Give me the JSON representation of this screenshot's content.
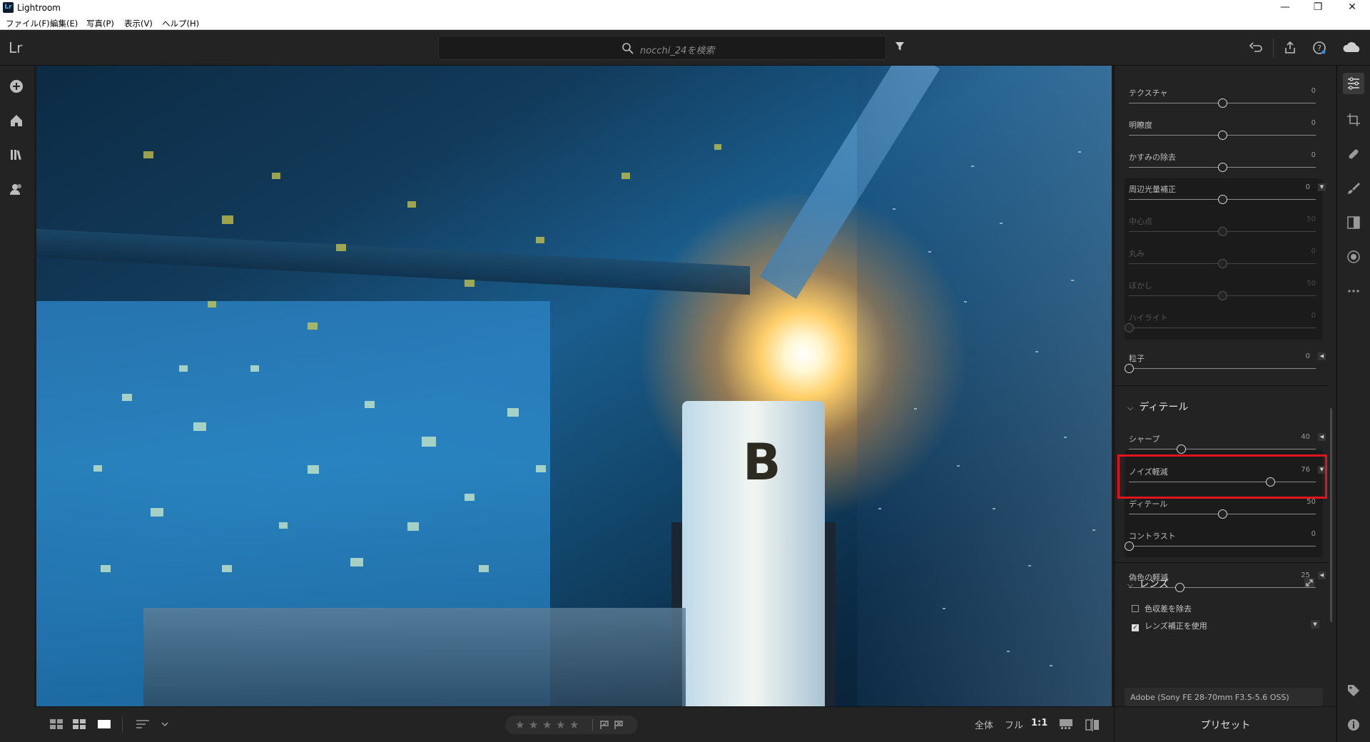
{
  "window": {
    "title": "Lightroom",
    "app_icon_text": "Lr",
    "minimize_glyph": "—",
    "maximize_glyph": "❐",
    "close_glyph": "✕"
  },
  "menu": {
    "file": "ファイル(F)",
    "edit": "編集(E)",
    "photo": "写真(P)",
    "view": "表示(V)",
    "help": "ヘルプ(H)"
  },
  "toolbar": {
    "logo": "Lr",
    "search_placeholder": "nocchi_24を検索"
  },
  "panel": {
    "effects_sliders": [
      {
        "label": "テクスチャ",
        "value": "0",
        "fraction": 0.5,
        "dim": false
      },
      {
        "label": "明瞭度",
        "value": "0",
        "fraction": 0.5,
        "dim": false
      },
      {
        "label": "かすみの除去",
        "value": "0",
        "fraction": 0.5,
        "dim": false
      }
    ],
    "vignette": {
      "label": "周辺光量補正",
      "value": "0",
      "fraction": 0.5
    },
    "vignette_sub": [
      {
        "label": "中心点",
        "value": "50",
        "fraction": 0.5
      },
      {
        "label": "丸み",
        "value": "0",
        "fraction": 0.5
      },
      {
        "label": "ぼかし",
        "value": "50",
        "fraction": 0.5
      },
      {
        "label": "ハイライト",
        "value": "0",
        "fraction": 0.0
      }
    ],
    "grain": {
      "label": "粒子",
      "value": "0",
      "fraction": 0.0
    },
    "detail_header": "ディテール",
    "sharpen": {
      "label": "シャープ",
      "value": "40",
      "fraction": 0.28
    },
    "noise_reduction": {
      "label": "ノイズ軽減",
      "value": "76",
      "fraction": 0.755
    },
    "noise_sub": [
      {
        "label": "ディテール",
        "value": "50",
        "fraction": 0.5
      },
      {
        "label": "コントラスト",
        "value": "0",
        "fraction": 0.0
      }
    ],
    "color_noise": {
      "label": "偽色の軽減",
      "value": "25",
      "fraction": 0.27
    },
    "lens_header": "レンズ",
    "remove_ca": {
      "label": "色収差を除去",
      "checked": false
    },
    "enable_profile": {
      "label": "レンズ補正を使用",
      "checked": true
    },
    "profile_name": "Adobe (Sony FE 28-70mm F3.5-5.6 OSS)"
  },
  "bottom": {
    "zoom_fit": "全体",
    "zoom_fill": "フル",
    "zoom_1to1": "1:1",
    "stars": [
      "★",
      "★",
      "★",
      "★",
      "★"
    ],
    "presets": "プリセット"
  },
  "colors": {
    "highlight_border": "#e0131e",
    "panel_bg": "#232323"
  }
}
